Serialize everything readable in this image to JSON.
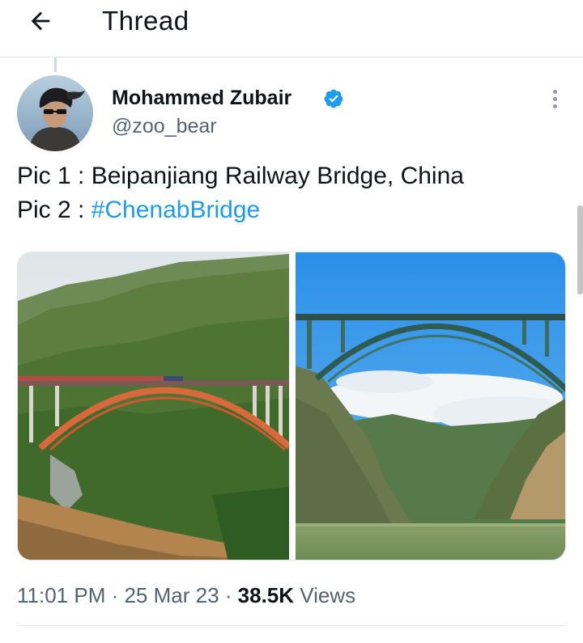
{
  "header": {
    "title": "Thread",
    "back_icon": "arrow-left-icon"
  },
  "tweet": {
    "author": {
      "name": "Mohammed Zubair",
      "handle": "@zoo_bear",
      "verified": true
    },
    "text": {
      "line1": "Pic 1 : Beipanjiang Railway Bridge, China",
      "line2_prefix": "Pic 2 : ",
      "line2_hashtag": "#ChenabBridge"
    },
    "media": [
      {
        "alt": "Beipanjiang Railway Bridge, China"
      },
      {
        "alt": "Chenab Bridge"
      }
    ],
    "meta": {
      "time": "11:01 PM",
      "separator": " · ",
      "date": "25 Mar 23",
      "views_count": "38.5K",
      "views_label": " Views"
    }
  },
  "colors": {
    "accent": "#1d9bf0",
    "text_primary": "#0f1419",
    "text_secondary": "#536471",
    "divider": "#e1e6ea"
  }
}
